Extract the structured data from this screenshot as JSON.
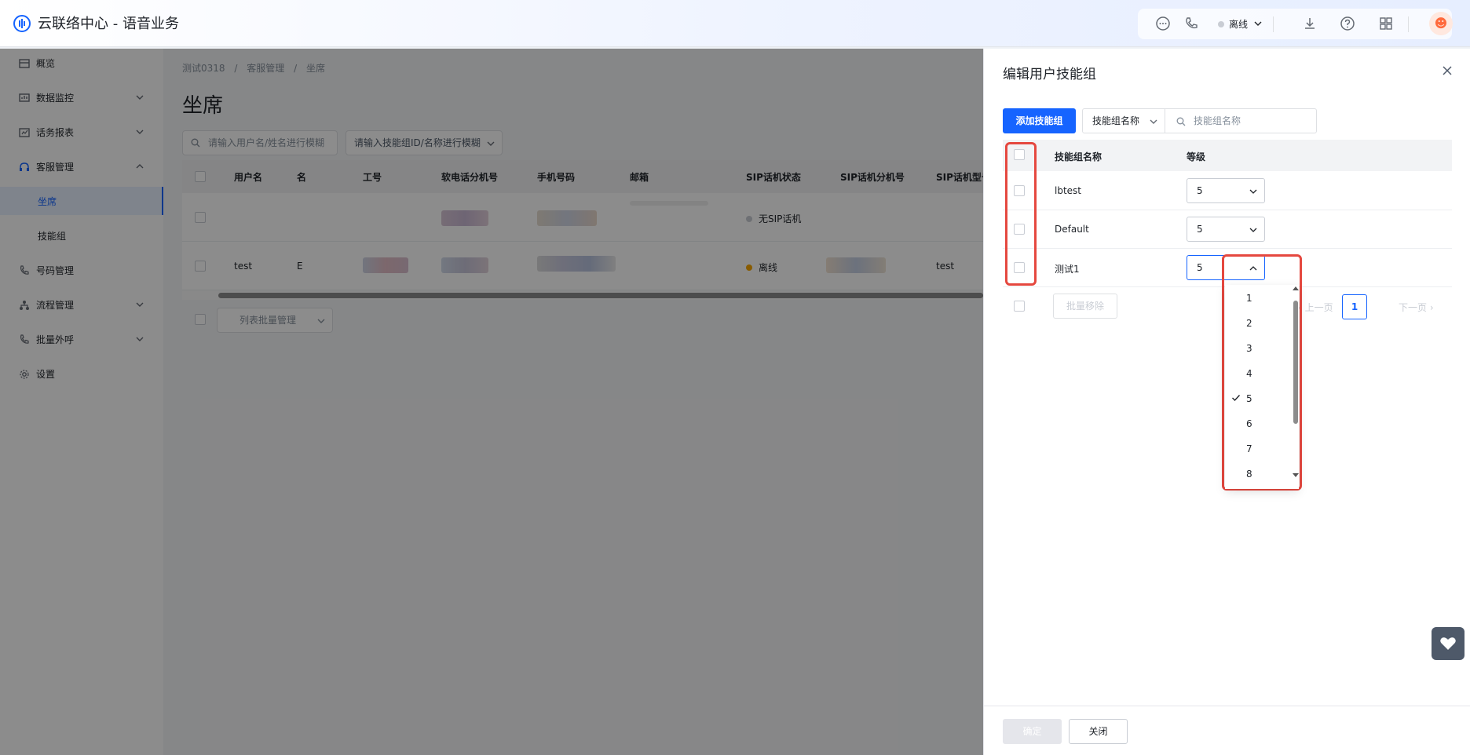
{
  "app": {
    "title": "云联络中心 - 语音业务"
  },
  "topbar": {
    "status_label": "离线"
  },
  "sidebar": {
    "items": [
      {
        "label": "概览"
      },
      {
        "label": "数据监控"
      },
      {
        "label": "话务报表"
      },
      {
        "label": "客服管理"
      },
      {
        "label": "坐席"
      },
      {
        "label": "技能组"
      },
      {
        "label": "号码管理"
      },
      {
        "label": "流程管理"
      },
      {
        "label": "批量外呼"
      },
      {
        "label": "设置"
      }
    ]
  },
  "main": {
    "breadcrumb": [
      "测试0318",
      "/",
      "客服管理",
      "/",
      "坐席"
    ],
    "title": "坐席",
    "search_user_placeholder": "请输入用户名/姓名进行模糊",
    "search_skill_placeholder": "请输入技能组ID/名称进行模糊",
    "table": {
      "headers": [
        "用户名",
        "名",
        "工号",
        "软电话分机号",
        "手机号码",
        "邮箱",
        "SIP话机状态",
        "SIP话机分机号",
        "SIP话机型号"
      ],
      "rows": [
        {
          "username": "",
          "sip_status": "无SIP话机",
          "sip_model": ""
        },
        {
          "username": "test",
          "name_fragment": "E",
          "sip_status": "离线",
          "sip_model": "test"
        }
      ]
    },
    "batch_manage_label": "列表批量管理"
  },
  "drawer": {
    "title": "编辑用户技能组",
    "add_button": "添加技能组",
    "filter_select": "技能组名称",
    "search_placeholder": "技能组名称",
    "headers": [
      "技能组名称",
      "等级"
    ],
    "rows": [
      {
        "name": "lbtest",
        "level": "5"
      },
      {
        "name": "Default",
        "level": "5"
      },
      {
        "name": "测试1",
        "level": "5"
      }
    ],
    "level_options": [
      "1",
      "2",
      "3",
      "4",
      "5",
      "6",
      "7",
      "8"
    ],
    "selected_level": "5",
    "batch_remove": "批量移除",
    "prev_page": "上一页",
    "page": "1",
    "next_page": "下一页",
    "confirm": "确定",
    "close": "关闭"
  },
  "colors": {
    "primary": "#1664ff",
    "highlight": "#e5483f",
    "offline": "#f7a600"
  }
}
